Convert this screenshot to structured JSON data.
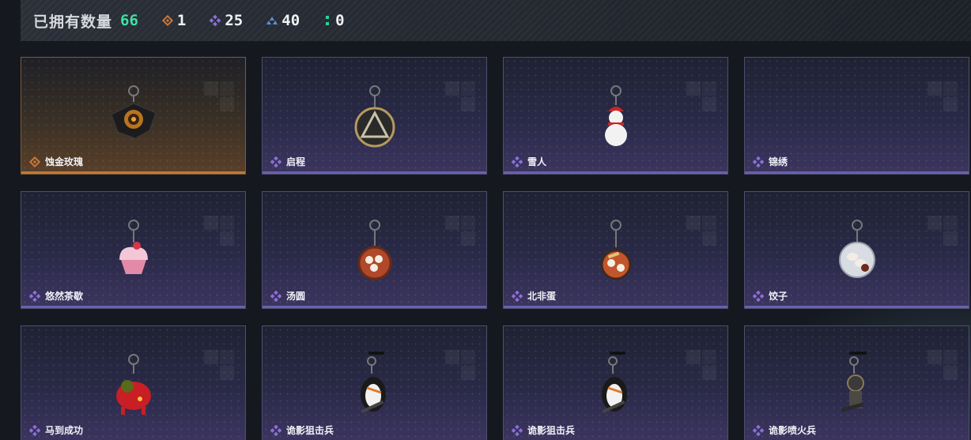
{
  "header": {
    "owned_label": "已拥有数量",
    "owned_count": "66",
    "stats": [
      {
        "icon": "orange-diamond-icon",
        "value": "1",
        "color": "#c9783a"
      },
      {
        "icon": "purple-diamond-icon",
        "value": "25",
        "color": "#8d6fd8"
      },
      {
        "icon": "blue-triangle-icon",
        "value": "40",
        "color": "#5a8fd6"
      },
      {
        "icon": "green-dots-icon",
        "value": "0",
        "color": "#2fcf9a"
      }
    ]
  },
  "colors": {
    "accent_green": "#3fe0a6",
    "rarity_gold": "#c9783a",
    "rarity_purple": "#8d6fd8"
  },
  "items": [
    {
      "name": "蚀金玫瑰",
      "rarity": "gold",
      "art": "gold-rose-charm-icon"
    },
    {
      "name": "启程",
      "rarity": "purple",
      "art": "medallion-charm-icon"
    },
    {
      "name": "雪人",
      "rarity": "purple",
      "art": "snowman-charm-icon"
    },
    {
      "name": "锦绣",
      "rarity": "purple",
      "art": ""
    },
    {
      "name": "悠然茶歇",
      "rarity": "purple",
      "art": "cupcake-charm-icon"
    },
    {
      "name": "汤圆",
      "rarity": "purple",
      "art": "tangyuan-bowl-charm-icon"
    },
    {
      "name": "北非蛋",
      "rarity": "purple",
      "art": "shakshuka-pan-charm-icon"
    },
    {
      "name": "饺子",
      "rarity": "purple",
      "art": "dumpling-plate-charm-icon"
    },
    {
      "name": "马到成功",
      "rarity": "purple",
      "art": "red-horse-charm-icon"
    },
    {
      "name": "诡影狙击兵",
      "rarity": "purple",
      "art": "penguin-sniper-charm-icon"
    },
    {
      "name": "诡影狙击兵",
      "rarity": "purple",
      "art": "penguin-sniper-charm-icon"
    },
    {
      "name": "诡影喷火兵",
      "rarity": "purple",
      "art": "flamethrower-soldier-charm-icon"
    }
  ]
}
